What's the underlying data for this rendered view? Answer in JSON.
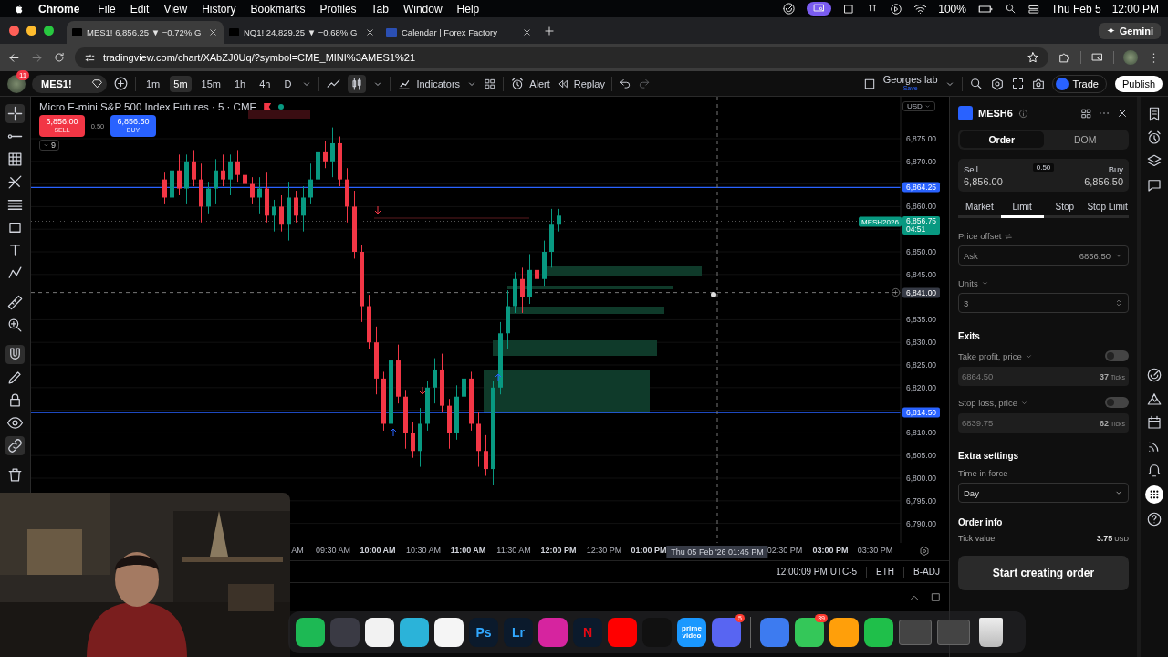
{
  "menubar": {
    "app": "Chrome",
    "menus": [
      "File",
      "Edit",
      "View",
      "History",
      "Bookmarks",
      "Profiles",
      "Tab",
      "Window",
      "Help"
    ],
    "battery": "100%",
    "date": "Thu Feb 5",
    "time": "12:00 PM"
  },
  "tabs": [
    {
      "title": "MES1! 6,856.25 ▼ −0.72% G",
      "selected": true,
      "kind": "chart"
    },
    {
      "title": "NQ1! 24,829.25 ▼ −0.68% G",
      "selected": false,
      "kind": "chart"
    },
    {
      "title": "Calendar | Forex Factory",
      "selected": false,
      "kind": "calendar"
    }
  ],
  "gemini": "Gemini",
  "url": "tradingview.com/chart/XAbZJ0Uq/?symbol=CME_MINI%3AMES1%21",
  "toolbar": {
    "avatar_badge": "11",
    "symbol": "MES1!",
    "intervals": [
      {
        "label": "1m",
        "selected": false
      },
      {
        "label": "5m",
        "selected": true
      },
      {
        "label": "15m",
        "selected": false
      },
      {
        "label": "1h",
        "selected": false
      },
      {
        "label": "4h",
        "selected": false
      },
      {
        "label": "D",
        "selected": false
      }
    ],
    "indicators": "Indicators",
    "alert": "Alert",
    "replay": "Replay",
    "layout_name": "Georges lab",
    "layout_status": "Save",
    "trade": "Trade",
    "publish": "Publish"
  },
  "chart": {
    "title": "Micro E-mini S&P 500 Index Futures · 5 · CME",
    "sell": {
      "price": "6,856.00",
      "label": "SELL"
    },
    "spread": "0.50",
    "buy": {
      "price": "6,856.50",
      "label": "BUY"
    },
    "indicator_count": "9",
    "currency": "USD",
    "price_labels": [
      "6,875.00",
      "6,870.00",
      "6,860.00",
      "6,850.00",
      "6,845.00",
      "6,835.00",
      "6,830.00",
      "6,825.00",
      "6,820.00",
      "6,810.00",
      "6,805.00",
      "6,800.00",
      "6,795.00",
      "6,790.00"
    ],
    "price_tags": [
      {
        "kind": "line",
        "value": "6,864.25"
      },
      {
        "kind": "last",
        "symbol": "MESH2026",
        "value": "6,856.75",
        "countdown": "04:51"
      },
      {
        "kind": "crosshair",
        "value": "6,841.00"
      },
      {
        "kind": "line",
        "value": "6,814.50"
      }
    ],
    "time_labels": [
      {
        "label": "AM",
        "major": false
      },
      {
        "label": "09:30 AM",
        "major": false
      },
      {
        "label": "10:00 AM",
        "major": true
      },
      {
        "label": "10:30 AM",
        "major": false
      },
      {
        "label": "11:00 AM",
        "major": true
      },
      {
        "label": "11:30 AM",
        "major": false
      },
      {
        "label": "12:00 PM",
        "major": true
      },
      {
        "label": "12:30 PM",
        "major": false
      },
      {
        "label": "01:00 PM",
        "major": true
      },
      {
        "label": "02:30 PM",
        "major": false
      },
      {
        "label": "03:00 PM",
        "major": true
      },
      {
        "label": "03:30 PM",
        "major": false
      }
    ],
    "crosshair_time": "Thu 05 Feb '26  01:45 PM",
    "status": [
      "12:00:09 PM UTC-5",
      "ETH",
      "B-ADJ"
    ]
  },
  "order_panel": {
    "symbol": "MESH6",
    "tabs": [
      {
        "label": "Order",
        "selected": true
      },
      {
        "label": "DOM",
        "selected": false
      }
    ],
    "sell_label": "Sell",
    "sell_price": "6,856.00",
    "spread": "0.50",
    "buy_label": "Buy",
    "buy_price": "6,856.50",
    "order_types": [
      {
        "label": "Market",
        "selected": false
      },
      {
        "label": "Limit",
        "selected": true
      },
      {
        "label": "Stop",
        "selected": false
      },
      {
        "label": "Stop Limit",
        "selected": false
      }
    ],
    "price_offset_label": "Price offset",
    "price_offset": {
      "value": "Ask",
      "price": "6856.50"
    },
    "units_label": "Units",
    "units": "3",
    "exits_heading": "Exits",
    "exits": [
      {
        "label": "Take profit, price",
        "on": false,
        "value": "6864.50",
        "ticks": "37",
        "ticks_unit": "Ticks"
      },
      {
        "label": "Stop loss, price",
        "on": false,
        "value": "6839.75",
        "ticks": "62",
        "ticks_unit": "Ticks"
      }
    ],
    "extra_heading": "Extra settings",
    "tif_label": "Time in force",
    "tif": "Day",
    "info_heading": "Order info",
    "tick_value_label": "Tick value",
    "tick_value": "3.75",
    "tick_value_unit": "USD",
    "submit": "Start creating order"
  },
  "dock": [
    {
      "kind": "app",
      "color": "#1db954"
    },
    {
      "kind": "app",
      "color": "#3a3a44"
    },
    {
      "kind": "app",
      "color": "#f2f2f2"
    },
    {
      "kind": "app",
      "color": "#2bb3d9"
    },
    {
      "kind": "app",
      "color": "#f5f5f5"
    },
    {
      "kind": "letter",
      "label": "Ps",
      "color": "#31a8ff"
    },
    {
      "kind": "letter",
      "label": "Lr",
      "color": "#31a8ff"
    },
    {
      "kind": "app",
      "color": "#d6249f"
    },
    {
      "kind": "letter",
      "label": "N",
      "color": "#e50914"
    },
    {
      "kind": "app",
      "color": "#ff0000"
    },
    {
      "kind": "app",
      "color": "#111111"
    },
    {
      "kind": "label",
      "label": "prime video",
      "color": "#1a98ff"
    },
    {
      "kind": "app",
      "color": "#5865f2",
      "badge": "5"
    },
    {
      "kind": "separator"
    },
    {
      "kind": "app",
      "color": "#3d7bf0"
    },
    {
      "kind": "app",
      "color": "#34c759",
      "badge": "39"
    },
    {
      "kind": "app",
      "color": "#ff9f0a"
    },
    {
      "kind": "app",
      "color": "#1fbf4a"
    },
    {
      "kind": "window"
    },
    {
      "kind": "window"
    },
    {
      "kind": "trash"
    }
  ]
}
